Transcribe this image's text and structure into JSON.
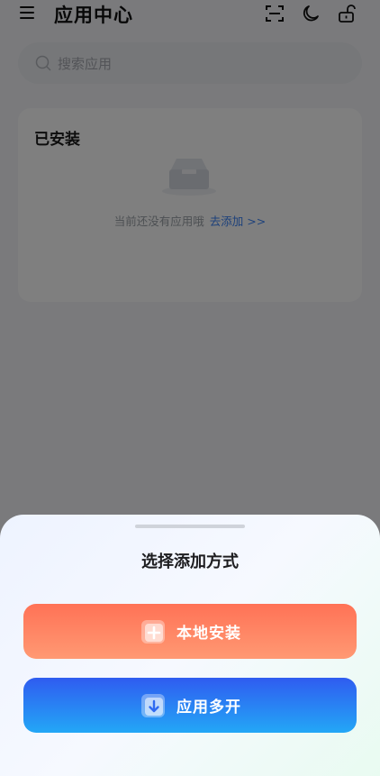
{
  "header": {
    "title": "应用中心"
  },
  "search": {
    "placeholder": "搜索应用"
  },
  "installed": {
    "title": "已安装",
    "empty_text": "当前还没有应用哦",
    "add_link": "去添加 >>"
  },
  "sheet": {
    "title": "选择添加方式",
    "options": [
      {
        "label": "本地安装",
        "icon": "plus-icon",
        "color": "#ff7b5c"
      },
      {
        "label": "应用多开",
        "icon": "download-icon",
        "color": "#2f7ef4"
      }
    ]
  }
}
